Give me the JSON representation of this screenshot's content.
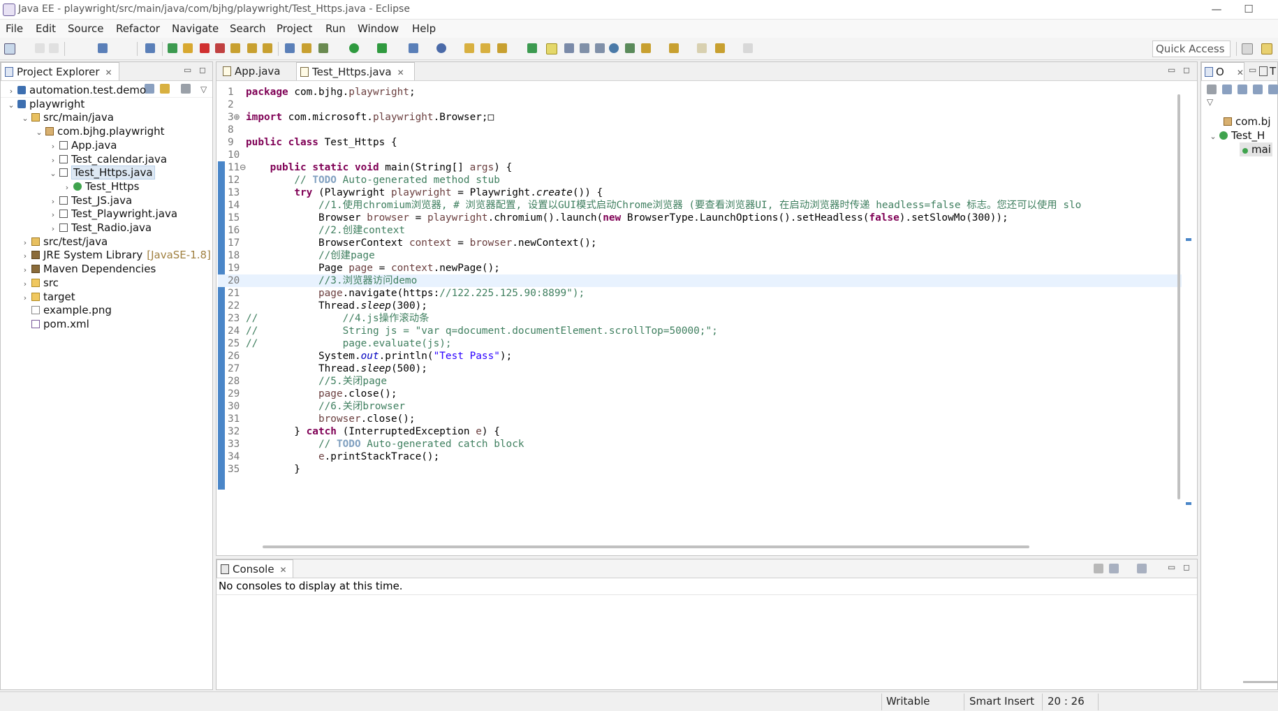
{
  "window": {
    "title": "Java EE - playwright/src/main/java/com/bjhg/playwright/Test_Https.java - Eclipse"
  },
  "menu": [
    "File",
    "Edit",
    "Source",
    "Refactor",
    "Navigate",
    "Search",
    "Project",
    "Run",
    "Window",
    "Help"
  ],
  "toolbar": {
    "quick_access": "Quick Access"
  },
  "project_explorer": {
    "title": "Project Explorer",
    "items": [
      {
        "label": "automation.test.demo",
        "arrow": "›",
        "icon": "project-icon"
      },
      {
        "label": "playwright",
        "arrow": "⌄",
        "icon": "project-icon"
      },
      {
        "label": "src/main/java",
        "arrow": "⌄",
        "icon": "source-folder-icon"
      },
      {
        "label": "com.bjhg.playwright",
        "arrow": "⌄",
        "icon": "package-icon"
      },
      {
        "label": "App.java",
        "arrow": "›",
        "icon": "java-file-icon"
      },
      {
        "label": "Test_calendar.java",
        "arrow": "›",
        "icon": "java-file-icon"
      },
      {
        "label": "Test_Https.java",
        "arrow": "⌄",
        "icon": "java-file-icon"
      },
      {
        "label": "Test_Https",
        "arrow": "›",
        "icon": "class-icon"
      },
      {
        "label": "Test_JS.java",
        "arrow": "›",
        "icon": "java-file-icon"
      },
      {
        "label": "Test_Playwright.java",
        "arrow": "›",
        "icon": "java-file-icon"
      },
      {
        "label": "Test_Radio.java",
        "arrow": "›",
        "icon": "java-file-icon"
      },
      {
        "label": "src/test/java",
        "arrow": "›",
        "icon": "source-folder-icon"
      },
      {
        "label": "JRE System Library",
        "decoration": "[JavaSE-1.8]",
        "arrow": "›",
        "icon": "library-icon"
      },
      {
        "label": "Maven Dependencies",
        "arrow": "›",
        "icon": "library-icon"
      },
      {
        "label": "src",
        "arrow": "›",
        "icon": "folder-icon"
      },
      {
        "label": "target",
        "arrow": "›",
        "icon": "folder-icon"
      },
      {
        "label": "example.png",
        "arrow": "",
        "icon": "file-icon"
      },
      {
        "label": "pom.xml",
        "arrow": "",
        "icon": "xml-file-icon"
      }
    ]
  },
  "editor": {
    "tabs": [
      {
        "label": "App.java"
      },
      {
        "label": "Test_Https.java"
      }
    ],
    "lines": [
      {
        "n": "1",
        "t": "package com.bjhg.playwright;"
      },
      {
        "n": "2",
        "t": ""
      },
      {
        "n": "3⊕",
        "t": "import com.microsoft.playwright.Browser;□"
      },
      {
        "n": "8",
        "t": ""
      },
      {
        "n": "9",
        "t": "public class Test_Https {"
      },
      {
        "n": "10",
        "t": ""
      },
      {
        "n": "11⊖",
        "t": "    public static void main(String[] args) {"
      },
      {
        "n": "12",
        "t": "        // TODO Auto-generated method stub"
      },
      {
        "n": "13",
        "t": "        try (Playwright playwright = Playwright.create()) {"
      },
      {
        "n": "14",
        "t": "            //1.使用chromium浏览器, # 浏览器配置, 设置以GUI模式启动Chrome浏览器 (要查看浏览器UI, 在启动浏览器时传递 headless=false 标志。您还可以使用 slo"
      },
      {
        "n": "15",
        "t": "            Browser browser = playwright.chromium().launch(new BrowserType.LaunchOptions().setHeadless(false).setSlowMo(300));"
      },
      {
        "n": "16",
        "t": "            //2.创建context"
      },
      {
        "n": "17",
        "t": "            BrowserContext context = browser.newContext();"
      },
      {
        "n": "18",
        "t": "            //创建page"
      },
      {
        "n": "19",
        "t": "            Page page = context.newPage();"
      },
      {
        "n": "20",
        "t": "            //3.浏览器访问demo"
      },
      {
        "n": "21",
        "t": "            page.navigate(\"https://122.225.125.90:8899\");"
      },
      {
        "n": "22",
        "t": "            Thread.sleep(300);"
      },
      {
        "n": "23",
        "t": "//              //4.js操作滚动条"
      },
      {
        "n": "24",
        "t": "//              String js = \"var q=document.documentElement.scrollTop=50000;\";"
      },
      {
        "n": "25",
        "t": "//              page.evaluate(js);"
      },
      {
        "n": "26",
        "t": "            System.out.println(\"Test Pass\");"
      },
      {
        "n": "27",
        "t": "            Thread.sleep(500);"
      },
      {
        "n": "28",
        "t": "            //5.关闭page"
      },
      {
        "n": "29",
        "t": "            page.close();"
      },
      {
        "n": "30",
        "t": "            //6.关闭browser"
      },
      {
        "n": "31",
        "t": "            browser.close();"
      },
      {
        "n": "32",
        "t": "        } catch (InterruptedException e) {"
      },
      {
        "n": "33",
        "t": "            // TODO Auto-generated catch block"
      },
      {
        "n": "34",
        "t": "            e.printStackTrace();"
      },
      {
        "n": "35",
        "t": "        }"
      }
    ]
  },
  "outline": {
    "tab_label": "O",
    "tab2_label": "T",
    "items": [
      "com.bj",
      "Test_H",
      "mai"
    ]
  },
  "console": {
    "title": "Console",
    "message": "No consoles to display at this time."
  },
  "status": {
    "writable": "Writable",
    "insert_mode": "Smart Insert",
    "position": "20 : 26"
  },
  "colors": {
    "keyword": "#7f0055",
    "comment": "#3f7f5f",
    "string": "#2a00ff",
    "selection": "#dde8f4"
  }
}
